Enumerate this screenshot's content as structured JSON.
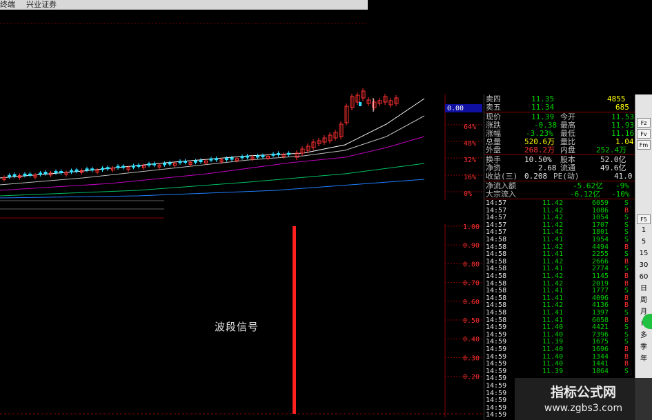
{
  "titlebar": {
    "left_text": "终端",
    "broker": "兴业证券"
  },
  "price_axis": [
    "0.00",
    "64%",
    "48%",
    "32%",
    "16%",
    "0%"
  ],
  "indicator_axis": [
    "1.00",
    "0.90",
    "0.80",
    "0.70",
    "0.60",
    "0.50",
    "0.40",
    "0.30",
    "0.20"
  ],
  "signal_label": "波段信号",
  "quote": {
    "sell4": {
      "label": "卖四",
      "price": "11.35",
      "vol": "4855"
    },
    "sell5": {
      "label": "卖五",
      "price": "11.34",
      "vol": "685"
    },
    "now": {
      "label": "现价",
      "value": "11.39",
      "label2": "今开",
      "value2": "11.53"
    },
    "change": {
      "label": "涨跌",
      "value": "-0.38",
      "label2": "最高",
      "value2": "11.93"
    },
    "pct": {
      "label": "涨幅",
      "value": "-3.23%",
      "label2": "最低",
      "value2": "11.16"
    },
    "total": {
      "label": "总量",
      "value": "520.6万",
      "label2": "量比",
      "value2": "1.04"
    },
    "outer": {
      "label": "外盘",
      "value": "268.2万",
      "label2": "内盘",
      "value2": "252.4万"
    },
    "turnover": {
      "label": "换手",
      "value": "10.50%",
      "label2": "股本",
      "value2": "52.0亿"
    },
    "net": {
      "label": "净资",
      "value": "2.68",
      "label2": "流通",
      "value2": "49.6亿"
    },
    "eps": {
      "label": "收益(三)",
      "value": "0.208",
      "label2": "PE(动)",
      "value2": "41.0"
    },
    "netflow": {
      "label": "净流入额",
      "value": "-5.62亿",
      "pct": "-9%"
    },
    "bigflow": {
      "label": "大宗流入",
      "value": "-6.12亿",
      "pct": "-10%"
    }
  },
  "trades": [
    [
      "14:57",
      "11.42",
      "6059",
      "S"
    ],
    [
      "14:57",
      "11.42",
      "1086",
      "B"
    ],
    [
      "14:57",
      "11.42",
      "1054",
      "S"
    ],
    [
      "14:57",
      "11.42",
      "1707",
      "S"
    ],
    [
      "14:57",
      "11.42",
      "1801",
      "S"
    ],
    [
      "14:58",
      "11.41",
      "1954",
      "S"
    ],
    [
      "14:58",
      "11.42",
      "4494",
      "B"
    ],
    [
      "14:58",
      "11.41",
      "2255",
      "S"
    ],
    [
      "14:58",
      "11.42",
      "2666",
      "B"
    ],
    [
      "14:58",
      "11.41",
      "2774",
      "S"
    ],
    [
      "14:58",
      "11.42",
      "1145",
      "B"
    ],
    [
      "14:58",
      "11.42",
      "2019",
      "B"
    ],
    [
      "14:58",
      "11.41",
      "1777",
      "S"
    ],
    [
      "14:58",
      "11.41",
      "4096",
      "B"
    ],
    [
      "14:58",
      "11.42",
      "4136",
      "B"
    ],
    [
      "14:58",
      "11.41",
      "1397",
      "S"
    ],
    [
      "14:58",
      "11.41",
      "6058",
      "B"
    ],
    [
      "14:59",
      "11.40",
      "4421",
      "S"
    ],
    [
      "14:59",
      "11.40",
      "7396",
      "S"
    ],
    [
      "14:59",
      "11.39",
      "1675",
      "S"
    ],
    [
      "14:59",
      "11.40",
      "1696",
      "B"
    ],
    [
      "14:59",
      "11.40",
      "1344",
      "B"
    ],
    [
      "14:59",
      "11.40",
      "1441",
      "B"
    ],
    [
      "14:59",
      "11.39",
      "1864",
      "S"
    ],
    [
      "14:59",
      "",
      "",
      ""
    ],
    [
      "14:59",
      "",
      "",
      ""
    ],
    [
      "14:59",
      "",
      "",
      ""
    ],
    [
      "14:59",
      "",
      "",
      ""
    ],
    [
      "14:59",
      "",
      "",
      ""
    ],
    [
      "14:59",
      "",
      "",
      ""
    ]
  ],
  "toolbar": [
    "1",
    "5",
    "15",
    "30",
    "60",
    "日",
    "周",
    "月",
    "N",
    "多",
    "季",
    "年"
  ],
  "toolbar_boxes": [
    "Fz",
    "Fv",
    "Fm",
    "F5"
  ],
  "watermark": {
    "title": "指标公式网",
    "url": "www.zgbs3.com"
  },
  "colors": {
    "up": "#ff3030",
    "down": "#30e0ff",
    "ma1": "#ffffff",
    "ma2": "#c0c0c0",
    "ma3": "#c000c0",
    "ma4": "#00c060",
    "ma5": "#2080ff",
    "grid": "#8a0000",
    "signal": "#ff2020"
  }
}
